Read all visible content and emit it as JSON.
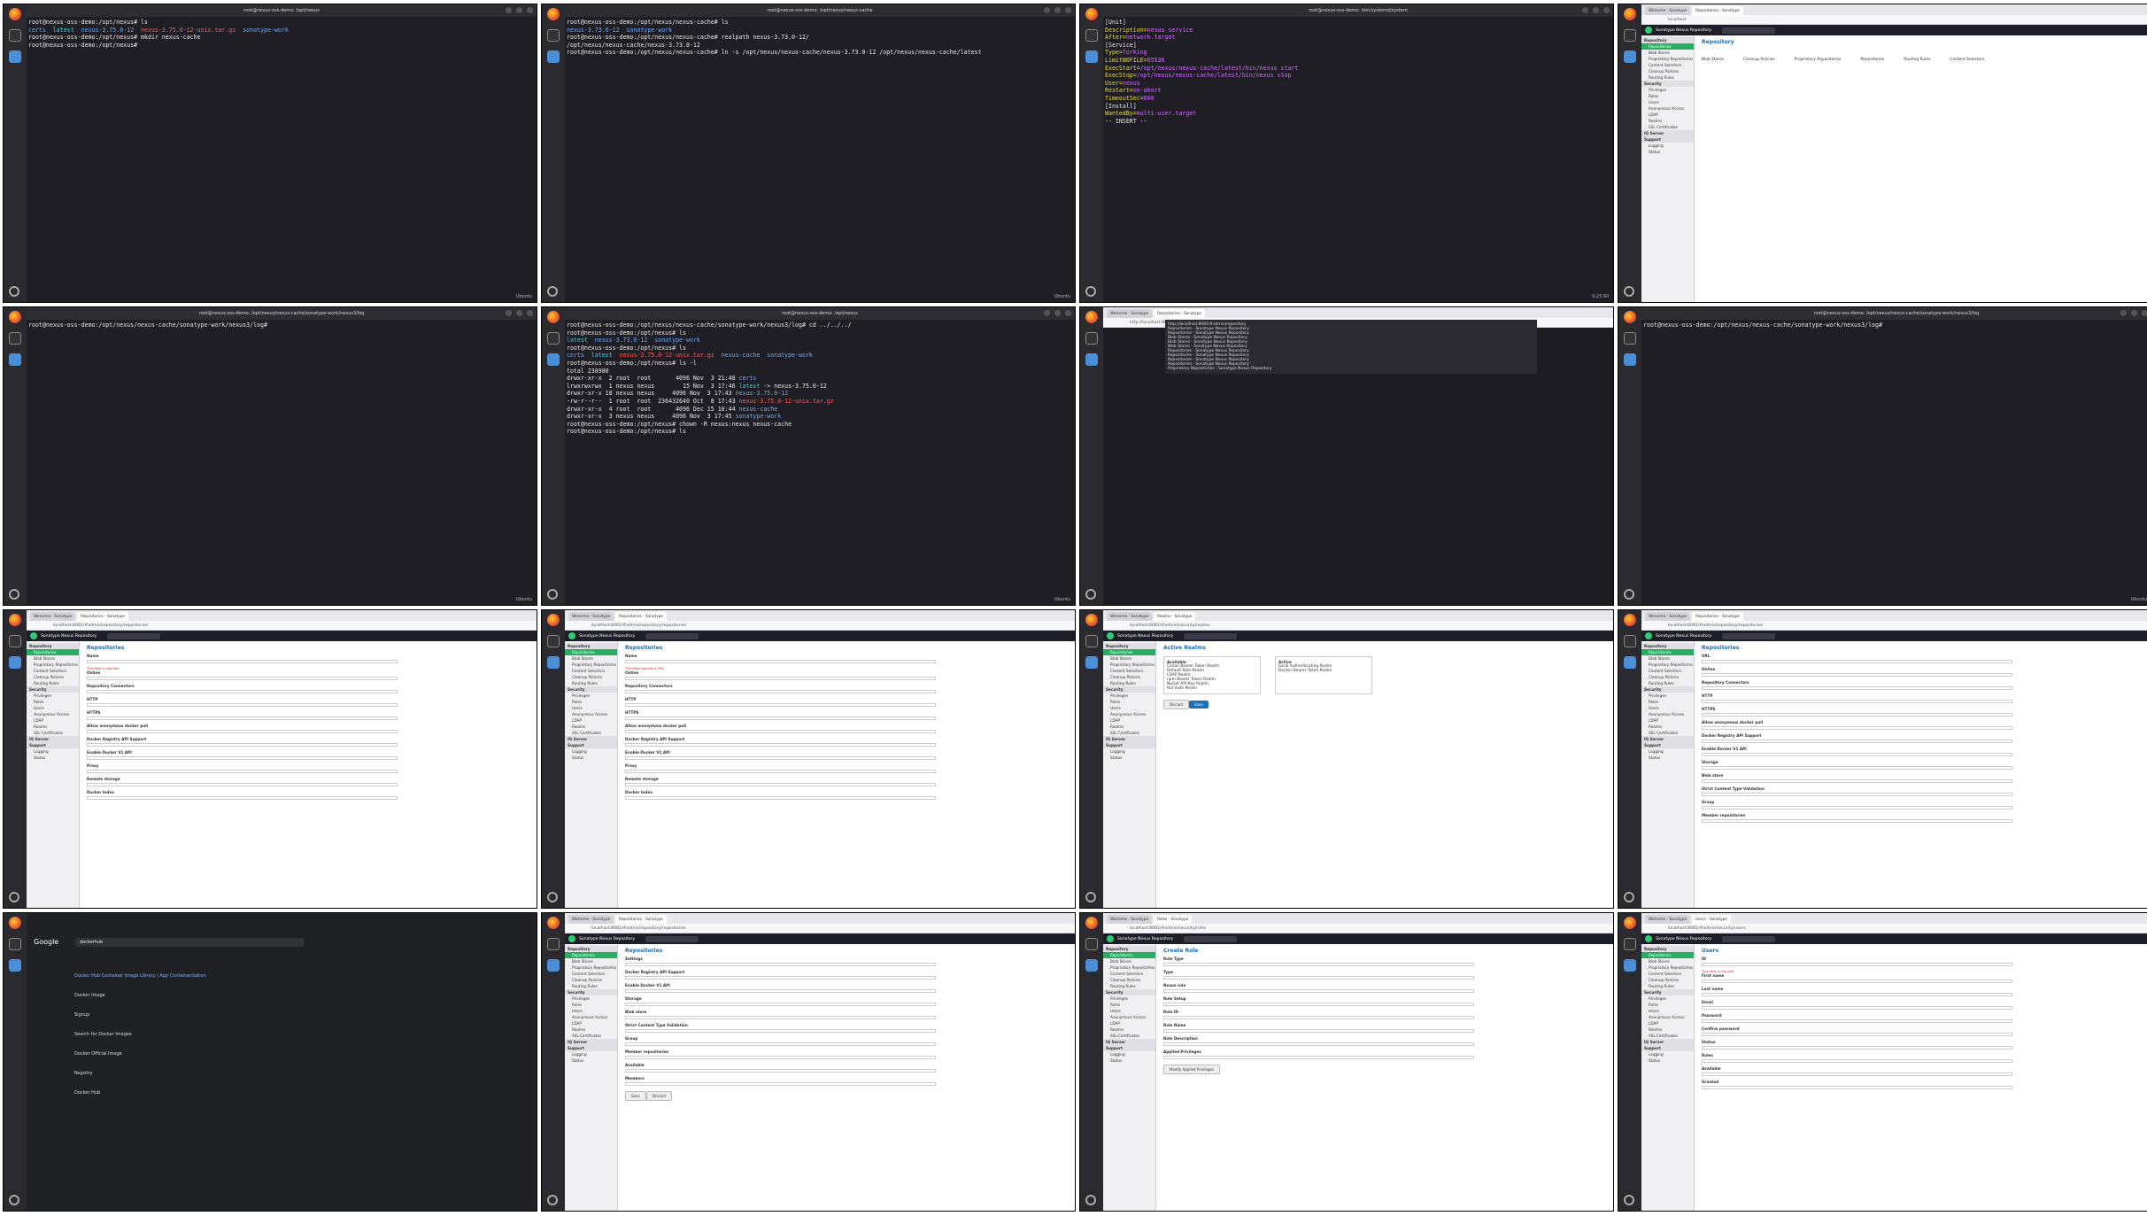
{
  "screens": [
    {
      "title": "root@nexus-oss-demo: /opt/nexus",
      "status": "Ubuntu",
      "lines": [
        {
          "segs": [
            {
              "t": "root@nexus-oss-demo:/opt/nexus# ls",
              "c": ""
            }
          ]
        },
        {
          "segs": [
            {
              "t": "certs  ",
              "c": "c-blue"
            },
            {
              "t": "latest  ",
              "c": "c-cyan"
            },
            {
              "t": "nexus-3.75.0-12  ",
              "c": "c-blue"
            },
            {
              "t": "nexus-3.75.0-12-unix.tar.gz  ",
              "c": "c-red"
            },
            {
              "t": "sonatype-work",
              "c": "c-blue"
            }
          ]
        },
        {
          "segs": [
            {
              "t": "root@nexus-oss-demo:/opt/nexus# mkdir nexus-cache",
              "c": ""
            }
          ]
        },
        {
          "segs": [
            {
              "t": "root@nexus-oss-demo:/opt/nexus# ",
              "c": ""
            }
          ]
        }
      ]
    },
    {
      "title": "root@nexus-oss-demo: /opt/nexus/nexus-cache",
      "status": "Ubuntu",
      "lines": [
        {
          "segs": [
            {
              "t": "root@nexus-oss-demo:/opt/nexus/nexus-cache# ls",
              "c": ""
            }
          ]
        },
        {
          "segs": [
            {
              "t": "nexus-3.73.0-12  ",
              "c": "c-blue"
            },
            {
              "t": "sonatype-work",
              "c": "c-blue"
            }
          ]
        },
        {
          "segs": [
            {
              "t": "root@nexus-oss-demo:/opt/nexus/nexus-cache# realpath nexus-3.73.0-12/",
              "c": ""
            }
          ]
        },
        {
          "segs": [
            {
              "t": "/opt/nexus/nexus-cache/nexus-3.73.0-12",
              "c": ""
            }
          ]
        },
        {
          "segs": [
            {
              "t": "root@nexus-oss-demo:/opt/nexus/nexus-cache# ln -s /opt/nexus/nexus-cache/nexus-3.73.0-12 /opt/nexus/nexus-cache/latest",
              "c": ""
            }
          ]
        }
      ]
    },
    {
      "title": "root@nexus-oss-demo: /etc/systemd/system",
      "status": "9,23          All",
      "lines": [
        {
          "segs": [
            {
              "t": "[Unit]",
              "c": ""
            }
          ]
        },
        {
          "segs": [
            {
              "t": "Description=",
              "c": "c-yel"
            },
            {
              "t": "nexus service",
              "c": "c-mag"
            }
          ]
        },
        {
          "segs": [
            {
              "t": "After=",
              "c": "c-yel"
            },
            {
              "t": "network.target",
              "c": "c-mag"
            }
          ]
        },
        {
          "segs": [
            {
              "t": "",
              "c": ""
            }
          ]
        },
        {
          "segs": [
            {
              "t": "[Service]",
              "c": ""
            }
          ]
        },
        {
          "segs": [
            {
              "t": "Type=",
              "c": "c-yel"
            },
            {
              "t": "forking",
              "c": "c-mag"
            }
          ]
        },
        {
          "segs": [
            {
              "t": "LimitNOFILE=",
              "c": "c-yel"
            },
            {
              "t": "65536",
              "c": "c-mag"
            }
          ]
        },
        {
          "segs": [
            {
              "t": "ExecStart=",
              "c": "c-yel"
            },
            {
              "t": "/opt/nexus/nexus-cache/latest/bin/nexus start",
              "c": "c-mag"
            }
          ]
        },
        {
          "segs": [
            {
              "t": "ExecStop=",
              "c": "c-yel"
            },
            {
              "t": "/opt/nexus/nexus-cache/latest/bin/nexus stop",
              "c": "c-mag"
            }
          ]
        },
        {
          "segs": [
            {
              "t": "User=",
              "c": "c-yel"
            },
            {
              "t": "nexus",
              "c": "c-mag"
            }
          ]
        },
        {
          "segs": [
            {
              "t": "Restart=",
              "c": "c-yel"
            },
            {
              "t": "on-abort",
              "c": "c-mag"
            }
          ]
        },
        {
          "segs": [
            {
              "t": "TimeoutSec=",
              "c": "c-yel"
            },
            {
              "t": "600",
              "c": "c-mag"
            }
          ]
        },
        {
          "segs": [
            {
              "t": "",
              "c": ""
            }
          ]
        },
        {
          "segs": [
            {
              "t": "[Install]",
              "c": ""
            }
          ]
        },
        {
          "segs": [
            {
              "t": "WantedBy=",
              "c": "c-yel"
            },
            {
              "t": "multi-user.target",
              "c": "c-mag"
            }
          ]
        },
        {
          "segs": [
            {
              "t": "-- INSERT --",
              "c": ""
            }
          ]
        }
      ]
    },
    {
      "title": "Repositories - Sonatype",
      "url": "localhost",
      "app": "Sonatype Nexus Repository",
      "heading": "Repository",
      "tiles": [
        "Blob Stores",
        "Cleanup Policies",
        "Proprietary Repositories",
        "Repositories",
        "Routing Rules",
        "Content Selectors"
      ],
      "side": [
        {
          "l": "Repository",
          "s": "sec"
        },
        {
          "l": "Repositories",
          "s": "act"
        },
        {
          "l": "Blob Stores"
        },
        {
          "l": "Proprietary Repositories"
        },
        {
          "l": "Content Selectors"
        },
        {
          "l": "Cleanup Policies"
        },
        {
          "l": "Routing Rules"
        },
        {
          "l": "Security",
          "s": "sec"
        },
        {
          "l": "Privileges"
        },
        {
          "l": "Roles"
        },
        {
          "l": "Users"
        },
        {
          "l": "Anonymous Access"
        },
        {
          "l": "LDAP"
        },
        {
          "l": "Realms"
        },
        {
          "l": "SSL Certificates"
        },
        {
          "l": "IQ Server",
          "s": "sec"
        },
        {
          "l": "Support",
          "s": "sec"
        },
        {
          "l": "Logging"
        },
        {
          "l": "Status"
        }
      ]
    },
    {
      "title": "root@nexus-oss-demo: /opt/nexus/nexus-cache/sonatype-work/nexus3/log",
      "status": "Ubuntu",
      "lines": [
        {
          "segs": [
            {
              "t": "root@nexus-oss-demo:/opt/nexus/nexus-cache/sonatype-work/nexus3/log# ",
              "c": ""
            }
          ]
        }
      ]
    },
    {
      "title": "root@nexus-oss-demo: /opt/nexus",
      "status": "Ubuntu",
      "lines": [
        {
          "segs": [
            {
              "t": "root@nexus-oss-demo:/opt/nexus/nexus-cache/sonatype-work/nexus3/log# cd ../../../",
              "c": ""
            }
          ]
        },
        {
          "segs": [
            {
              "t": "root@nexus-oss-demo:/opt/nexus# ls",
              "c": ""
            }
          ]
        },
        {
          "segs": [
            {
              "t": "latest  ",
              "c": "c-cyan"
            },
            {
              "t": "nexus-3.73.0-12  ",
              "c": "c-blue"
            },
            {
              "t": "sonatype-work",
              "c": "c-blue"
            }
          ]
        },
        {
          "segs": [
            {
              "t": "root@nexus-oss-demo:/opt/nexus# ls",
              "c": ""
            }
          ]
        },
        {
          "segs": [
            {
              "t": "certs  ",
              "c": "c-blue"
            },
            {
              "t": "latest  ",
              "c": "c-cyan"
            },
            {
              "t": "nexus-3.75.0-12-unix.tar.gz  ",
              "c": "c-red"
            },
            {
              "t": "nexus-cache  ",
              "c": "c-blue"
            },
            {
              "t": "sonatype-work",
              "c": "c-blue"
            }
          ]
        },
        {
          "segs": [
            {
              "t": "root@nexus-oss-demo:/opt/nexus# ls -l",
              "c": ""
            }
          ]
        },
        {
          "segs": [
            {
              "t": "total 238980",
              "c": ""
            }
          ]
        },
        {
          "segs": [
            {
              "t": "drwxr-xr-x  2 root  root       4096 Nov  3 21:48 ",
              "c": ""
            },
            {
              "t": "certs",
              "c": "c-blue"
            }
          ]
        },
        {
          "segs": [
            {
              "t": "lrwxrwxrwx  1 nexus nexus        15 Nov  3 17:46 ",
              "c": ""
            },
            {
              "t": "latest",
              "c": "c-cyan"
            },
            {
              "t": " -> nexus-3.75.0-12",
              "c": ""
            }
          ]
        },
        {
          "segs": [
            {
              "t": "drwxr-xr-x 10 nexus nexus     4096 Nov  3 17:43 ",
              "c": ""
            },
            {
              "t": "nexus-3.75.0-12",
              "c": "c-blue"
            }
          ]
        },
        {
          "segs": [
            {
              "t": "-rw-r--r--  1 root  root  236432640 Oct  8 17:43 ",
              "c": ""
            },
            {
              "t": "nexus-3.75.0-12-unix.tar.gz",
              "c": "c-red"
            }
          ]
        },
        {
          "segs": [
            {
              "t": "drwxr-xr-x  4 root  root       4096 Dec 15 10:44 ",
              "c": ""
            },
            {
              "t": "nexus-cache",
              "c": "c-blue"
            }
          ]
        },
        {
          "segs": [
            {
              "t": "drwxr-xr-x  3 nexus nexus     4096 Nov  3 17:45 ",
              "c": ""
            },
            {
              "t": "sonatype-work",
              "c": "c-blue"
            }
          ]
        },
        {
          "segs": [
            {
              "t": "root@nexus-oss-demo:/opt/nexus# chown -R nexus:nexus nexus-cache",
              "c": ""
            }
          ]
        },
        {
          "segs": [
            {
              "t": "root@nexus-oss-demo:/opt/nexus# ls",
              "c": ""
            }
          ]
        }
      ]
    },
    {
      "title": "Repositories - Sonatype",
      "url": "http://localhost:8081/#admin/repository",
      "history": [
        "Repositories - Sonatype Nexus Repository",
        "Repositories - Sonatype Nexus Repository",
        "Blob Stores - Sonatype Nexus Repository",
        "Blob Stores - Sonatype Nexus Repository",
        "Web Stores - Sonatype Nexus Repository",
        "Repositories - Sonatype Nexus Repository",
        "Repositories - Sonatype Nexus Repository",
        "Repositories - Sonatype Nexus Repository",
        "Repositories - Sonatype Nexus Repository",
        "Proprietary Repositories - Sonatype Nexus Repository"
      ]
    },
    {
      "title": "root@nexus-oss-demo: /opt/nexus/nexus-cache/sonatype-work/nexus3/log",
      "status": "Ubuntu",
      "lines": [
        {
          "segs": [
            {
              "t": "root@nexus-oss-demo:/opt/nexus/nexus-cache/sonatype-work/nexus3/log# ",
              "c": ""
            }
          ]
        }
      ]
    },
    {
      "title": "Repositories - Sonatype",
      "url": "localhost:8081/#admin/repository/repositories",
      "app": "Sonatype Nexus Repository",
      "heading": "Repositories",
      "fields": [
        "Name",
        "Online",
        "Repository Connectors",
        "HTTP",
        "HTTPS",
        "Allow anonymous docker pull",
        "Docker Registry API Support",
        "Enable Docker V1 API",
        "Proxy",
        "Remote storage",
        "Docker Index"
      ],
      "err": "This field is required"
    },
    {
      "title": "Repositories - Sonatype",
      "url": "localhost:8081/#admin/repository/repositories",
      "app": "Sonatype Nexus Repository",
      "heading": "Repositories",
      "fields": [
        "Name",
        "Online",
        "Repository Connectors",
        "HTTP",
        "HTTPS",
        "Allow anonymous docker pull",
        "Docker Registry API Support",
        "Enable Docker V1 API",
        "Proxy",
        "Remote storage",
        "Docker Index"
      ],
      "err": "This field requires a URL"
    },
    {
      "title": "Realms - Sonatype",
      "url": "localhost:8081/#admin/security/realms",
      "app": "Sonatype Nexus Repository",
      "heading": "Active Realms",
      "available": [
        "Conan Bearer Token Realm",
        "Default Role Realm",
        "LDAP Realm",
        "npm Bearer Token Realm",
        "NuGet API-Key Realm",
        "Rut Auth Realm"
      ],
      "active": [
        "Local Authenticating Realm",
        "Docker Bearer Token Realm"
      ],
      "buttons": [
        "Discard",
        "Save"
      ]
    },
    {
      "title": "Repositories - Sonatype",
      "url": "localhost:8081/#admin/repository/repositories",
      "app": "Sonatype Nexus Repository",
      "heading": "Repositories",
      "fields": [
        "URL",
        "Online",
        "Repository Connectors",
        "HTTP",
        "HTTPS",
        "Allow anonymous docker pull",
        "Docker Registry API Support",
        "Enable Docker V1 API",
        "Storage",
        "Blob store",
        "Strict Content Type Validation",
        "Group",
        "Member repositories"
      ]
    },
    {
      "title": "dockerhub - Google",
      "url": "https://www.google.com/search?q=dockerhub",
      "query": "dockerhub",
      "results": [
        "Docker Hub Container Image Library | App Containerization",
        "Docker Image",
        "Signup",
        "Search for Docker Images",
        "Docker Official Image",
        "Registry",
        "Docker Hub"
      ]
    },
    {
      "title": "Repositories - Sonatype",
      "url": "localhost:8081/#admin/repository/repositories",
      "app": "Sonatype Nexus Repository",
      "heading": "Repositories",
      "fields": [
        "Settings",
        "Docker Registry API Support",
        "Enable Docker V1 API",
        "Storage",
        "Blob store",
        "Strict Content Type Validation",
        "Group",
        "Member repositories",
        "Available",
        "Members"
      ],
      "buttons": [
        "Save",
        "Discard"
      ]
    },
    {
      "title": "Roles - Sonatype",
      "url": "localhost:8081/#admin/security/roles",
      "app": "Sonatype Nexus Repository",
      "heading": "Create Role",
      "fields": [
        "Role Type",
        "Type",
        "Nexus role",
        "Role Setup",
        "Role ID",
        "Role Name",
        "Role Description",
        "Applied Privileges"
      ],
      "buttons": [
        "Modify Applied Privileges"
      ]
    },
    {
      "title": "Users - Sonatype",
      "url": "localhost:8081/#admin/security/users",
      "app": "Sonatype Nexus Repository",
      "heading": "Users",
      "fields": [
        "ID",
        "First name",
        "Last name",
        "Email",
        "Password",
        "Confirm password",
        "Status",
        "Roles",
        "Available",
        "Granted"
      ],
      "err": "This field is required"
    }
  ]
}
